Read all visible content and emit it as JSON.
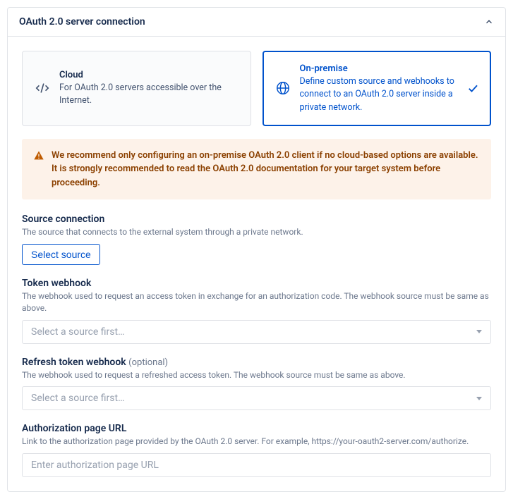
{
  "panel": {
    "title": "OAuth 2.0 server connection"
  },
  "options": {
    "cloud": {
      "title": "Cloud",
      "desc": "For OAuth 2.0 servers accessible over the Internet."
    },
    "onprem": {
      "title": "On-premise",
      "desc": "Define custom source and webhooks to connect to an OAuth 2.0 server inside a private network."
    }
  },
  "alert": {
    "text": "We recommend only configuring an on-premise OAuth 2.0 client if no cloud-based options are available. It is strongly recommended to read the OAuth 2.0 documentation for your target system before proceeding."
  },
  "fields": {
    "source": {
      "label": "Source connection",
      "help": "The source that connects to the external system through a private network.",
      "button": "Select source"
    },
    "token": {
      "label": "Token webhook",
      "help": "The webhook used to request an access token in exchange for an authorization code. The webhook source must be same as above.",
      "placeholder": "Select a source first…"
    },
    "refresh": {
      "label": "Refresh token webhook",
      "optional": "(optional)",
      "help": "The webhook used to request a refreshed access token. The webhook source must be same as above.",
      "placeholder": "Select a source first…"
    },
    "authurl": {
      "label": "Authorization page URL",
      "help": "Link to the authorization page provided by the OAuth 2.0 server. For example, https://your-oauth2-server.com/authorize.",
      "placeholder": "Enter authorization page URL"
    }
  }
}
